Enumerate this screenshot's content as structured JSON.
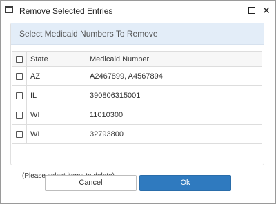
{
  "window": {
    "title": "Remove Selected Entries",
    "maximize_icon": "maximize-icon",
    "close_label": "✕"
  },
  "panel": {
    "title": "Select Medicaid Numbers To Remove"
  },
  "table": {
    "headers": {
      "state": "State",
      "number": "Medicaid Number"
    },
    "rows": [
      {
        "state": "AZ",
        "number": "A2467899, A4567894",
        "checked": false
      },
      {
        "state": "IL",
        "number": "390806315001",
        "checked": false
      },
      {
        "state": "WI",
        "number": "11010300",
        "checked": false
      },
      {
        "state": "WI",
        "number": "32793800",
        "checked": false
      }
    ]
  },
  "hint": "(Please select items to delete)",
  "buttons": {
    "cancel": "Cancel",
    "ok": "Ok"
  },
  "colors": {
    "panel_header": "#e3edf8",
    "primary_button": "#2f7abf"
  }
}
